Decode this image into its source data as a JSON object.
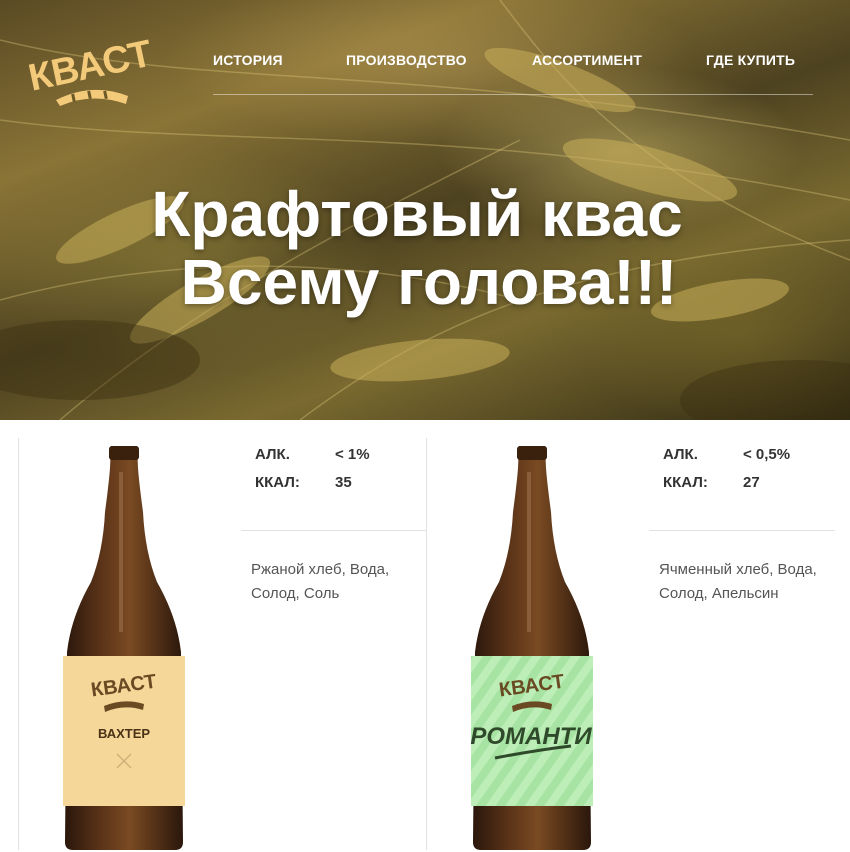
{
  "header": {
    "logo_text": "КВАСТ",
    "nav": [
      "ИСТОРИЯ",
      "ПРОИЗВОДСТВО",
      "АССОРТИМЕНТ",
      "ГДЕ КУПИТЬ"
    ]
  },
  "hero": {
    "line1": "Крафтовый квас",
    "line2": "Всему голова!!!"
  },
  "products": [
    {
      "label_brand": "КВАСТ",
      "label_name": "ВАХТЕР",
      "alc_label": "АЛК.",
      "alc_value": "< 1%",
      "kcal_label": "ККАЛ:",
      "kcal_value": "35",
      "ingredients": "Ржаной хлеб, Вода, Солод, Соль",
      "label_color": "#f6d79a"
    },
    {
      "label_brand": "КВАСТ",
      "label_name": "РОМАНТИ",
      "alc_label": "АЛК.",
      "alc_value": "< 0,5%",
      "kcal_label": "ККАЛ:",
      "kcal_value": "27",
      "ingredients": "Ячменный хлеб, Вода, Солод, Апельсин",
      "label_color": "#a7e3a3"
    }
  ],
  "colors": {
    "logo": "#f3c97a",
    "bottle": "#4a2a14",
    "text_dark": "#333333"
  }
}
